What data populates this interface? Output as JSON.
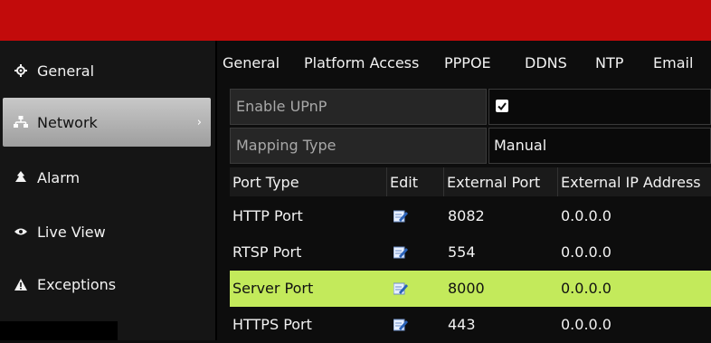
{
  "sidebar": {
    "items": [
      {
        "label": "General",
        "icon": "gear-icon"
      },
      {
        "label": "Network",
        "icon": "network-icon",
        "chevron": "›"
      },
      {
        "label": "Alarm",
        "icon": "alarm-icon"
      },
      {
        "label": "Live View",
        "icon": "eye-icon"
      },
      {
        "label": "Exceptions",
        "icon": "warning-icon"
      }
    ]
  },
  "tabs": [
    "General",
    "Platform Access",
    "PPPOE",
    "DDNS",
    "NTP",
    "Email"
  ],
  "fields": {
    "upnp": {
      "label": "Enable UPnP",
      "checked": true
    },
    "mapping": {
      "label": "Mapping Type",
      "value": "Manual"
    }
  },
  "table": {
    "headers": [
      "Port Type",
      "Edit",
      "External Port",
      "External IP Address"
    ],
    "rows": [
      {
        "type": "HTTP Port",
        "port": "8082",
        "ip": "0.0.0.0"
      },
      {
        "type": "RTSP Port",
        "port": "554",
        "ip": "0.0.0.0"
      },
      {
        "type": "Server Port",
        "port": "8000",
        "ip": "0.0.0.0"
      },
      {
        "type": "HTTPS Port",
        "port": "443",
        "ip": "0.0.0.0"
      }
    ]
  },
  "colors": {
    "topbar": "#c20b0b",
    "selected_row": "#c3ea5b"
  }
}
